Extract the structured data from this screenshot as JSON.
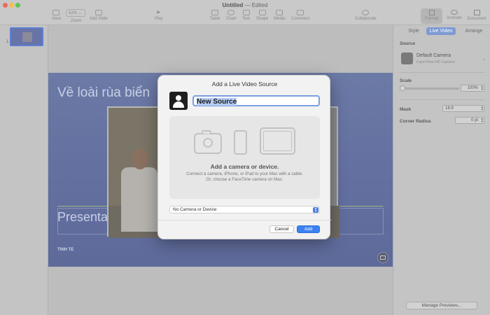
{
  "window": {
    "title": "Untitled",
    "status": "— Edited",
    "traffic_colors": {
      "close": "#ee6a5e",
      "min": "#f5bf4f",
      "max": "#61c554"
    }
  },
  "toolbar": {
    "view": "View",
    "zoom": "Zoom",
    "zoom_value": "62%",
    "add_slide": "Add Slide",
    "play": "Play",
    "table": "Table",
    "chart": "Chart",
    "text": "Text",
    "shape": "Shape",
    "media": "Media",
    "comment": "Comment",
    "collaborate": "Collaborate",
    "format": "Format",
    "animate": "Animate",
    "document": "Document"
  },
  "navigator": {
    "slide_number": "1"
  },
  "slide": {
    "title": "Về loài rùa biển",
    "subtitle": "Presenta",
    "author": "TINH TE"
  },
  "inspector": {
    "tabs": [
      "Style",
      "Live Video",
      "Arrange"
    ],
    "active_tab": "Live Video",
    "source_label": "Source",
    "source_name": "Default Camera",
    "source_device": "FaceTime HD Camera",
    "scale_label": "Scale",
    "scale_value": "100%",
    "mask_label": "Mask",
    "mask_value": "16:9",
    "corner_label": "Corner Radius",
    "corner_value": "0 pt",
    "manage_button": "Manage Previews..."
  },
  "dialog": {
    "title": "Add a Live Video Source",
    "name_value": "New Source",
    "drop_heading": "Add a camera or device.",
    "drop_body": "Connect a camera, iPhone, or iPad to your Mac with a cable. Or, choose a FaceTime camera on Mac.",
    "device_select": "No Camera or Device",
    "cancel": "Cancel",
    "add": "Add"
  }
}
